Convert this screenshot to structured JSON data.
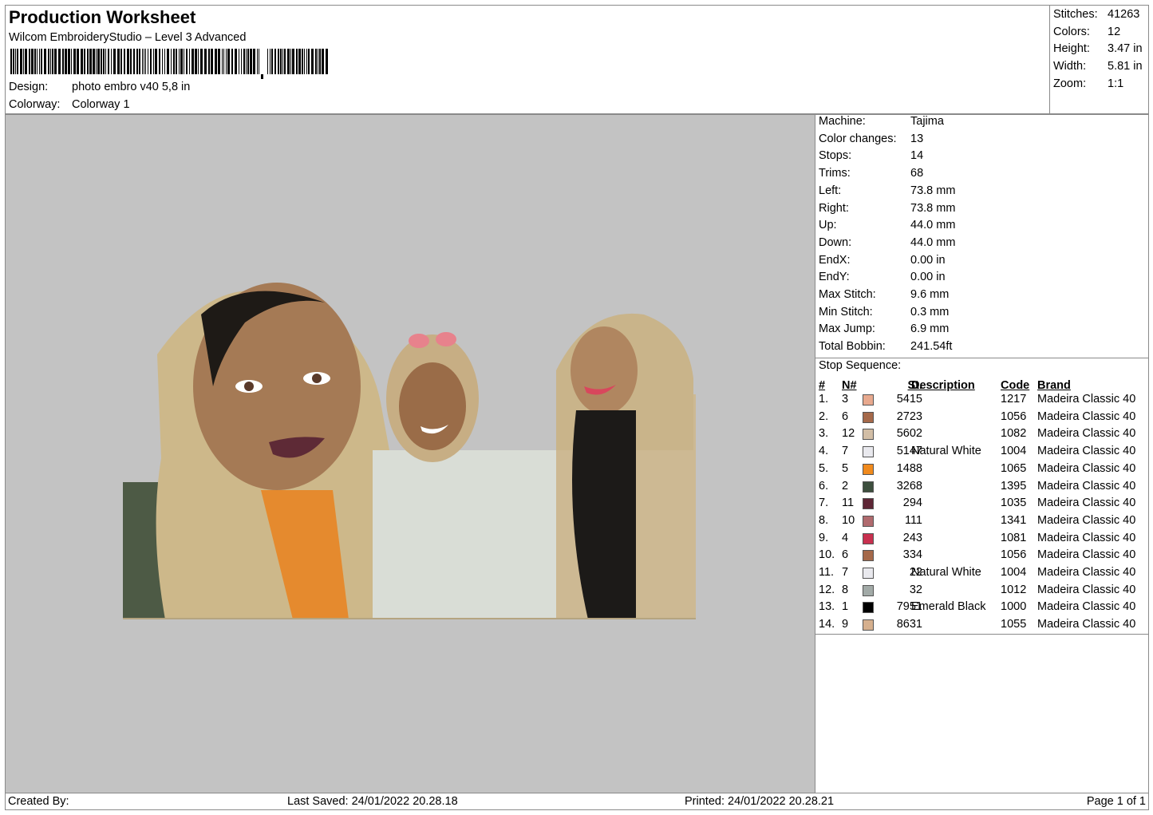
{
  "header": {
    "title": "Production Worksheet",
    "subtitle": "Wilcom EmbroideryStudio – Level 3 Advanced",
    "barcode_label": "barcode",
    "design_label": "Design:",
    "design_value": "photo embro v40 5,8 in",
    "colorway_label": "Colorway:",
    "colorway_value": "Colorway 1"
  },
  "summary": [
    {
      "label": "Stitches:",
      "value": "41263"
    },
    {
      "label": "Colors:",
      "value": "12"
    },
    {
      "label": "Height:",
      "value": "3.47 in"
    },
    {
      "label": "Width:",
      "value": "5.81 in"
    },
    {
      "label": "Zoom:",
      "value": "1:1"
    }
  ],
  "machine_info": [
    {
      "label": "Machine:",
      "value": "Tajima"
    },
    {
      "label": "Color changes:",
      "value": "13"
    },
    {
      "label": "Stops:",
      "value": "14"
    },
    {
      "label": "Trims:",
      "value": "68"
    },
    {
      "label": "Left:",
      "value": "73.8 mm"
    },
    {
      "label": "Right:",
      "value": "73.8 mm"
    },
    {
      "label": "Up:",
      "value": "44.0 mm"
    },
    {
      "label": "Down:",
      "value": "44.0 mm"
    },
    {
      "label": "EndX:",
      "value": "0.00 in"
    },
    {
      "label": "EndY:",
      "value": "0.00 in"
    },
    {
      "label": "Max Stitch:",
      "value": "9.6 mm"
    },
    {
      "label": "Min Stitch:",
      "value": "0.3 mm"
    },
    {
      "label": "Max Jump:",
      "value": "6.9 mm"
    },
    {
      "label": "Total Bobbin:",
      "value": "241.54ft"
    }
  ],
  "stop_sequence": {
    "title": "Stop Sequence:",
    "columns": {
      "num": "#",
      "n": "N#",
      "st": "St.",
      "description": "Description",
      "code": "Code",
      "brand": "Brand"
    },
    "rows": [
      {
        "num": "1.",
        "n": "3",
        "color": "#e8a98e",
        "st": "5415",
        "description": "",
        "code": "1217",
        "brand": "Madeira Classic 40"
      },
      {
        "num": "2.",
        "n": "6",
        "color": "#a5694a",
        "st": "2723",
        "description": "",
        "code": "1056",
        "brand": "Madeira Classic 40"
      },
      {
        "num": "3.",
        "n": "12",
        "color": "#d2bea6",
        "st": "5602",
        "description": "",
        "code": "1082",
        "brand": "Madeira Classic 40"
      },
      {
        "num": "4.",
        "n": "7",
        "color": "#e9e9ee",
        "st": "5147",
        "description": "Natural White",
        "code": "1004",
        "brand": "Madeira Classic 40"
      },
      {
        "num": "5.",
        "n": "5",
        "color": "#f08a1d",
        "st": "1488",
        "description": "",
        "code": "1065",
        "brand": "Madeira Classic 40"
      },
      {
        "num": "6.",
        "n": "2",
        "color": "#3d4f3e",
        "st": "3268",
        "description": "",
        "code": "1395",
        "brand": "Madeira Classic 40"
      },
      {
        "num": "7.",
        "n": "11",
        "color": "#5e2636",
        "st": "294",
        "description": "",
        "code": "1035",
        "brand": "Madeira Classic 40"
      },
      {
        "num": "8.",
        "n": "10",
        "color": "#b06a6e",
        "st": "111",
        "description": "",
        "code": "1341",
        "brand": "Madeira Classic 40"
      },
      {
        "num": "9.",
        "n": "4",
        "color": "#c8304f",
        "st": "243",
        "description": "",
        "code": "1081",
        "brand": "Madeira Classic 40"
      },
      {
        "num": "10.",
        "n": "6",
        "color": "#a5694a",
        "st": "334",
        "description": "",
        "code": "1056",
        "brand": "Madeira Classic 40"
      },
      {
        "num": "11.",
        "n": "7",
        "color": "#e9e9ee",
        "st": "22",
        "description": "Natural White",
        "code": "1004",
        "brand": "Madeira Classic 40"
      },
      {
        "num": "12.",
        "n": "8",
        "color": "#a2aaa7",
        "st": "32",
        "description": "",
        "code": "1012",
        "brand": "Madeira Classic 40"
      },
      {
        "num": "13.",
        "n": "1",
        "color": "#000000",
        "st": "7951",
        "description": "Emerald Black",
        "code": "1000",
        "brand": "Madeira Classic 40"
      },
      {
        "num": "14.",
        "n": "9",
        "color": "#d6b08e",
        "st": "8631",
        "description": "",
        "code": "1055",
        "brand": "Madeira Classic 40"
      }
    ]
  },
  "footer": {
    "created_by": "Created By:",
    "last_saved": "Last Saved: 24/01/2022 20.28.18",
    "printed": "Printed: 24/01/2022 20.28.21",
    "page": "Page 1 of 1"
  },
  "colors": {
    "preview_background": "#c3c3c3",
    "border": "#8a8a8a"
  }
}
